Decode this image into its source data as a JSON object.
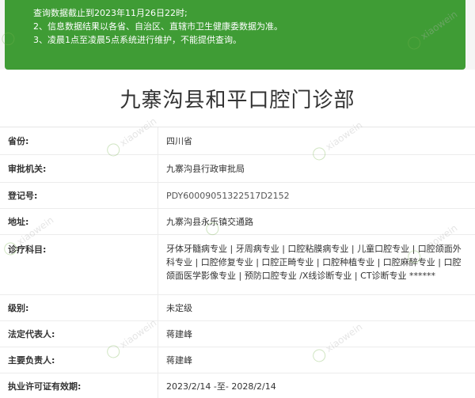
{
  "notice": {
    "lines": [
      "查询数据截止到2023年11月26日22时;",
      "2、信息数据结果以各省、自治区、直辖市卫生健康委数据为准。",
      "3、凌晨1点至凌晨5点系统进行维护，不能提供查询。"
    ]
  },
  "title": "九寨沟县和平口腔门诊部",
  "rows": [
    {
      "label": "省份:",
      "value": "四川省"
    },
    {
      "label": "审批机关:",
      "value": "九寨沟县行政审批局"
    },
    {
      "label": "登记号:",
      "value": "PDY60009051322517D2152"
    },
    {
      "label": "地址:",
      "value": "九寨沟县永乐镇交通路"
    },
    {
      "label": "诊疗科目:",
      "value": "牙体牙髓病专业 | 牙周病专业 | 口腔粘膜病专业 | 儿童口腔专业 | 口腔颌面外科专业 | 口腔修复专业 | 口腔正畸专业 | 口腔种植专业 | 口腔麻醉专业 | 口腔颌面医学影像专业 | 预防口腔专业 /X线诊断专业 | CT诊断专业 ******"
    },
    {
      "label": "级别:",
      "value": "未定级"
    },
    {
      "label": "法定代表人:",
      "value": "蒋建峰"
    },
    {
      "label": "主要负责人:",
      "value": "蒋建峰"
    },
    {
      "label": "执业许可证有效期:",
      "value": "2023/2/14 -至- 2028/2/14"
    }
  ],
  "watermark": {
    "text": "xiaowein",
    "logo": "tooth-logo-icon"
  }
}
